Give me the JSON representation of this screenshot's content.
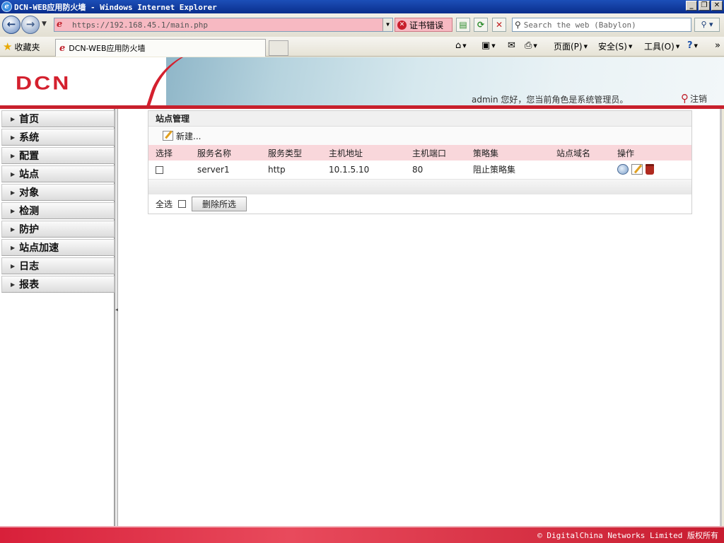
{
  "window": {
    "title": "DCN-WEB应用防火墙 - Windows Internet Explorer"
  },
  "browser": {
    "url": "https://192.168.45.1/main.php",
    "cert_error": "证书错误",
    "search_placeholder": "Search the web (Babylon)",
    "favorites": "收藏夹",
    "tab_title": "DCN-WEB应用防火墙",
    "menu": {
      "page": "页面(P)",
      "safety": "安全(S)",
      "tools": "工具(O)"
    }
  },
  "header": {
    "logo": "DCN",
    "welcome": "admin 您好，您当前角色是系统管理员。",
    "logout": "注销"
  },
  "sidebar": {
    "items": [
      {
        "label": "首页"
      },
      {
        "label": "系统"
      },
      {
        "label": "配置"
      },
      {
        "label": "站点"
      },
      {
        "label": "对象"
      },
      {
        "label": "检测"
      },
      {
        "label": "防护"
      },
      {
        "label": "站点加速"
      },
      {
        "label": "日志"
      },
      {
        "label": "报表"
      }
    ]
  },
  "panel": {
    "title": "站点管理",
    "new_label": "新建...",
    "columns": [
      "选择",
      "服务名称",
      "服务类型",
      "主机地址",
      "主机端口",
      "策略集",
      "站点域名",
      "操作"
    ],
    "rows": [
      {
        "name": "server1",
        "type": "http",
        "host": "10.1.5.10",
        "port": "80",
        "policy": "阻止策略集",
        "domain": ""
      }
    ],
    "select_all": "全选",
    "delete_selected": "删除所选"
  },
  "footer": {
    "copyright": "© DigitalChina Networks Limited 版权所有"
  }
}
